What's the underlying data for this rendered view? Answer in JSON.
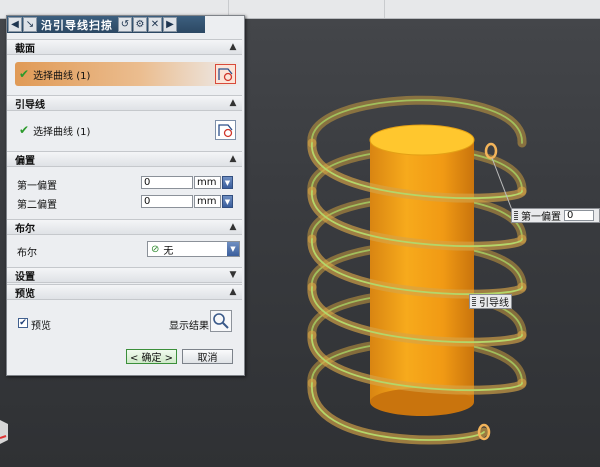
{
  "dialog": {
    "title": "沿引导线扫掠",
    "sections": {
      "section": {
        "title": "截面",
        "select_label": "选择曲线 (1)"
      },
      "guide": {
        "title": "引导线",
        "select_label": "选择曲线 (1)"
      },
      "offset": {
        "title": "偏置",
        "first_label": "第一偏置",
        "first_value": "0",
        "first_unit": "mm",
        "second_label": "第二偏置",
        "second_value": "0",
        "second_unit": "mm"
      },
      "boolean": {
        "title": "布尔",
        "label": "布尔",
        "value": "无"
      },
      "settings": {
        "title": "设置"
      },
      "preview": {
        "title": "预览",
        "checkbox_label": "预览",
        "checked": true,
        "show_result_label": "显示结果"
      }
    },
    "ok_label": "< 确定 >",
    "cancel_label": "取消"
  },
  "viewport": {
    "first_offset_tag": "第一偏置",
    "first_offset_value": "0",
    "guide_tag": "引导线"
  },
  "icons": [
    "back-icon",
    "arrow-icon",
    "reset-icon",
    "gear-icon",
    "close-icon",
    "chevron-up-icon",
    "chevron-down-icon",
    "checkmark-icon",
    "curve-select-icon",
    "spin-arrow-icon",
    "magnifier-icon"
  ],
  "colors": {
    "accent_orange": "#e09a56",
    "cylinder": "#f0a21a",
    "cylinder_top": "#ffc52a",
    "helix_glow": "#d9a84a",
    "helix_core": "#9bc95a",
    "title_bar": "#2c4863"
  }
}
